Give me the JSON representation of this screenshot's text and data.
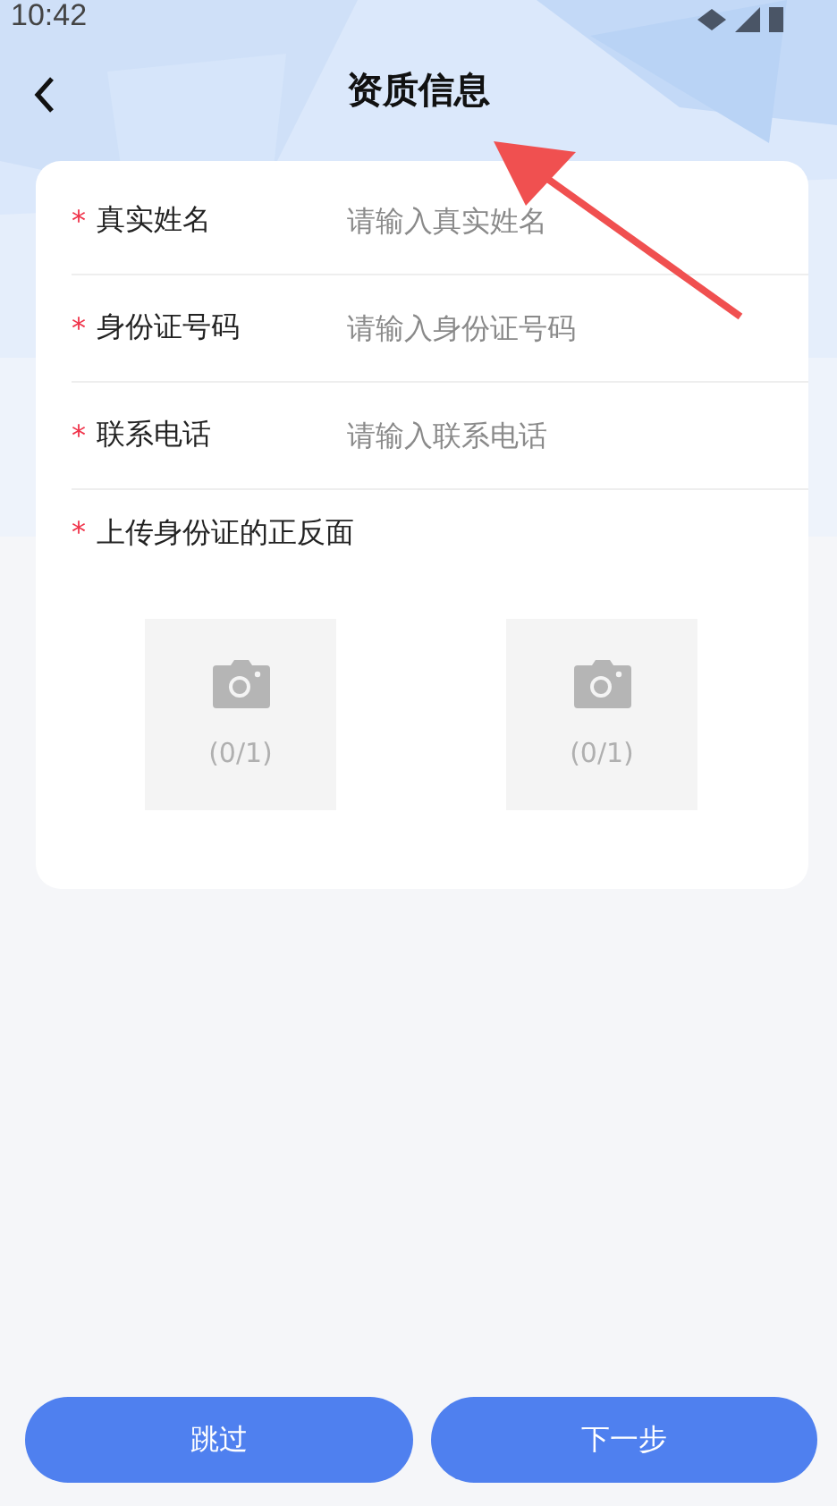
{
  "status_bar": {
    "time": "10:42"
  },
  "header": {
    "title": "资质信息"
  },
  "form": {
    "fields": [
      {
        "label": "真实姓名",
        "required_mark": "*",
        "placeholder": "请输入真实姓名"
      },
      {
        "label": "身份证号码",
        "required_mark": "*",
        "placeholder": "请输入身份证号码"
      },
      {
        "label": "联系电话",
        "required_mark": "*",
        "placeholder": "请输入联系电话"
      }
    ],
    "upload": {
      "label": "上传身份证的正反面",
      "required_mark": "*",
      "slots": [
        {
          "count": "(0/1)"
        },
        {
          "count": "(0/1)"
        }
      ]
    }
  },
  "buttons": [
    {
      "label": "跳过"
    },
    {
      "label": "下一步"
    }
  ]
}
